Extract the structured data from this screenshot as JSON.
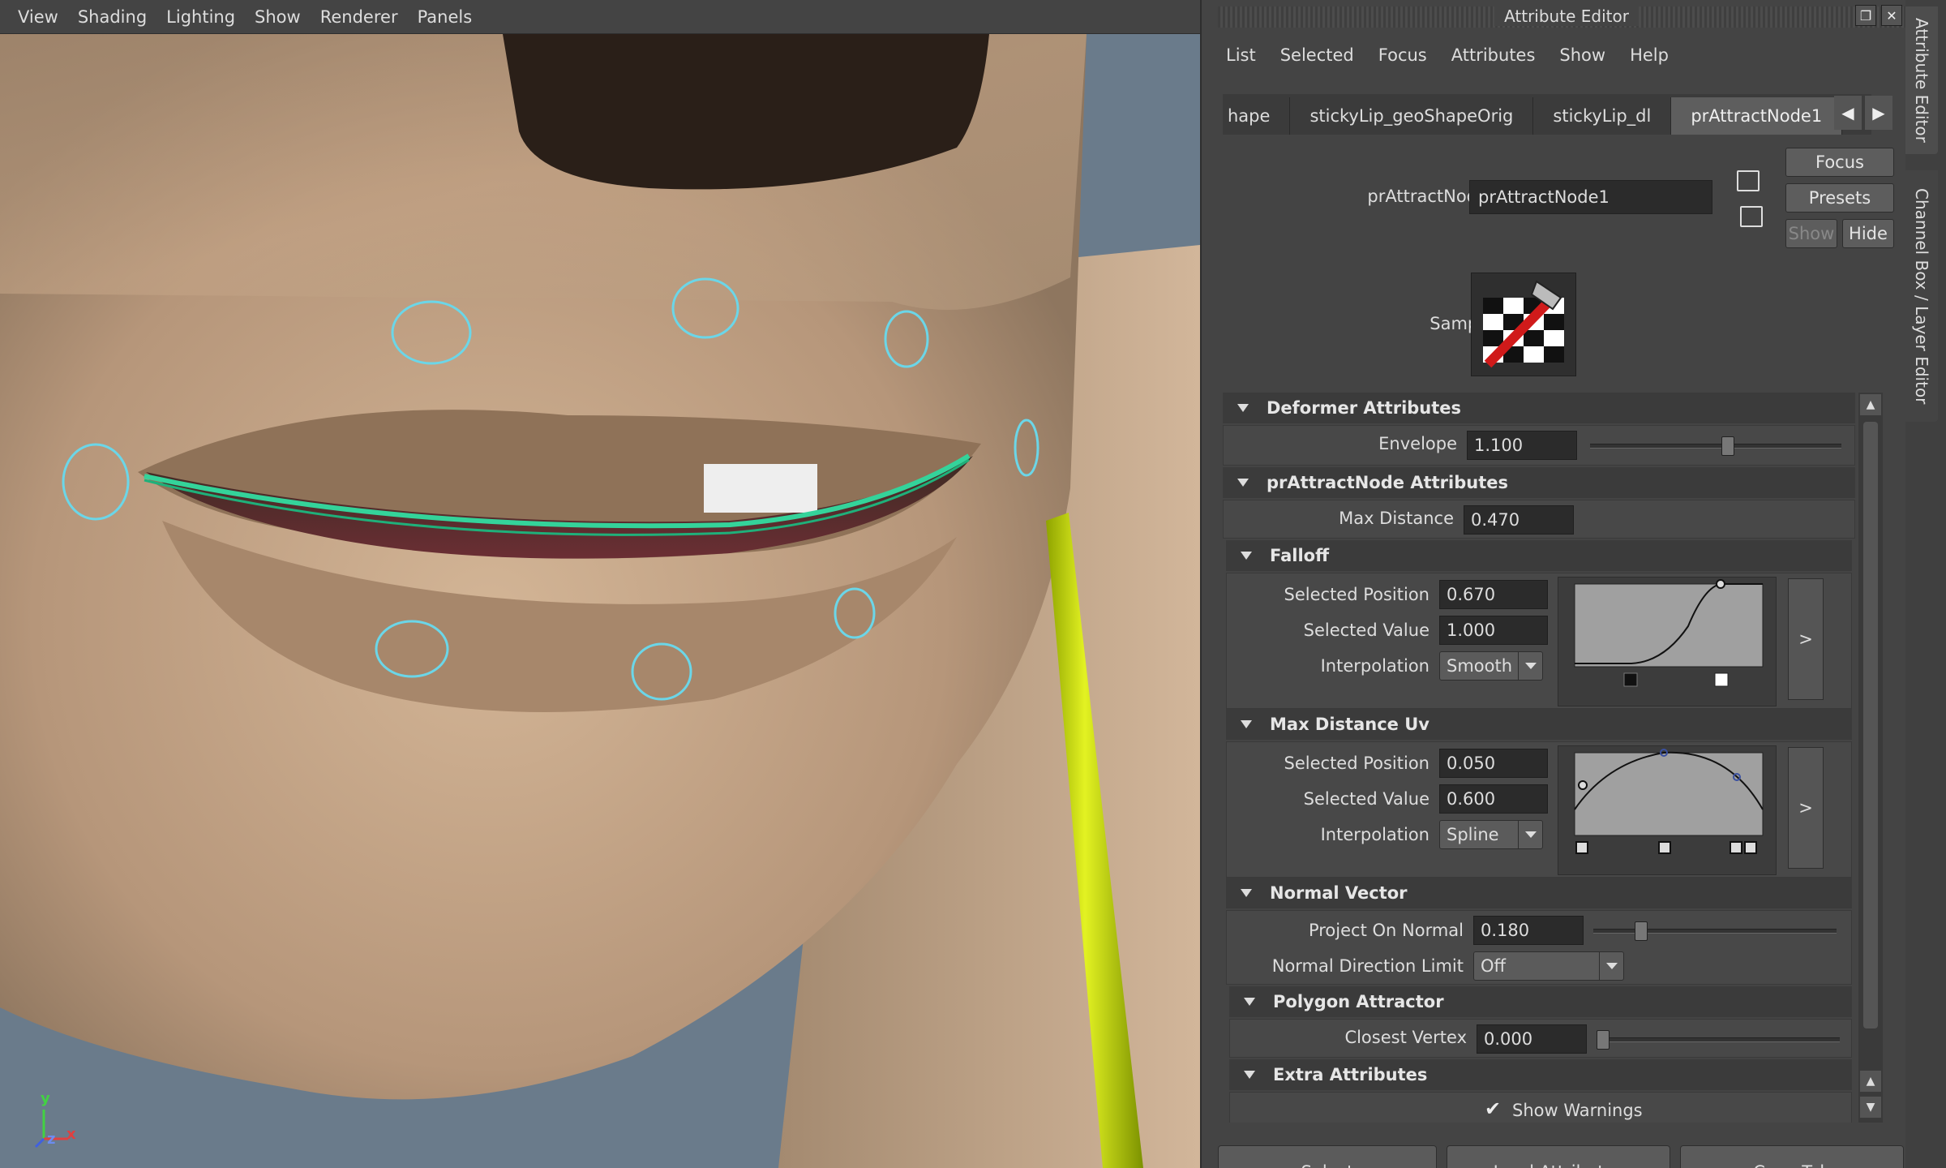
{
  "viewport": {
    "menu": [
      "View",
      "Shading",
      "Lighting",
      "Show",
      "Renderer",
      "Panels"
    ],
    "axis_labels": {
      "y": "y",
      "z": "z",
      "x": "x"
    }
  },
  "attribute_editor": {
    "title": "Attribute Editor",
    "menu": [
      "List",
      "Selected",
      "Focus",
      "Attributes",
      "Show",
      "Help"
    ],
    "tabs": [
      {
        "label": "hape",
        "active": false
      },
      {
        "label": "stickyLip_geoShapeOrig",
        "active": false
      },
      {
        "label": "stickyLip_dl",
        "active": false
      },
      {
        "label": "prAttractNode1",
        "active": true
      }
    ],
    "buttons": {
      "focus": "Focus",
      "presets": "Presets",
      "show": "Show",
      "hide": "Hide"
    },
    "node_label": "prAttractNode:",
    "node_value": "prAttractNode1",
    "sample_label": "Sample",
    "sections": {
      "deformer": {
        "title": "Deformer Attributes",
        "envelope_label": "Envelope",
        "envelope_value": "1.100",
        "envelope_level": 0.55
      },
      "attract": {
        "title": "prAttractNode Attributes",
        "max_distance_label": "Max Distance",
        "max_distance_value": "0.470"
      },
      "falloff": {
        "title": "Falloff",
        "selected_position_label": "Selected Position",
        "selected_position_value": "0.670",
        "selected_value_label": "Selected Value",
        "selected_value_value": "1.000",
        "interpolation_label": "Interpolation",
        "interpolation_value": "Smooth",
        "expand": ">"
      },
      "max_distance_uv": {
        "title": "Max Distance Uv",
        "selected_position_label": "Selected Position",
        "selected_position_value": "0.050",
        "selected_value_label": "Selected Value",
        "selected_value_value": "0.600",
        "interpolation_label": "Interpolation",
        "interpolation_value": "Spline",
        "expand": ">"
      },
      "normal_vector": {
        "title": "Normal Vector",
        "project_label": "Project On Normal",
        "project_value": "0.180",
        "project_level": 0.18,
        "direction_label": "Normal Direction Limit",
        "direction_value": "Off"
      },
      "polygon_attractor": {
        "title": "Polygon Attractor",
        "closest_label": "Closest Vertex",
        "closest_value": "0.000",
        "closest_level": 0.0
      },
      "extra": {
        "title": "Extra Attributes",
        "show_warnings_label": "Show Warnings",
        "show_warnings_checked": true
      }
    },
    "bottom_buttons": [
      "Select",
      "Load Attributes",
      "Copy Tab"
    ]
  },
  "side_tabs": [
    "Attribute Editor",
    "Channel Box / Layer Editor"
  ]
}
